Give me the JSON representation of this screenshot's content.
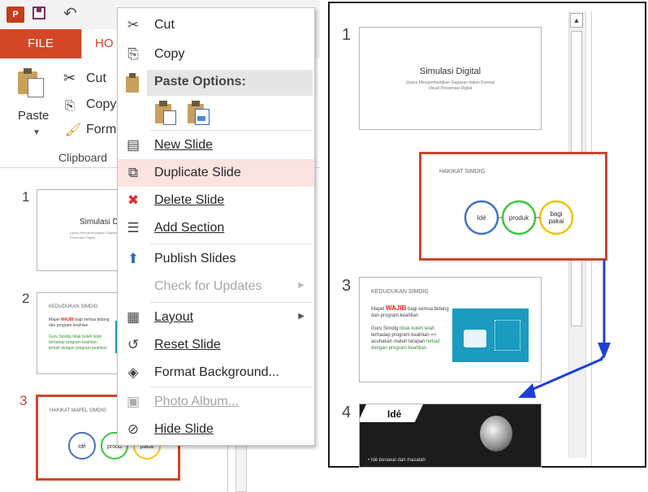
{
  "left": {
    "file_tab": "FILE",
    "home_tab": "HO",
    "ribbon": {
      "paste": "Paste",
      "cut": "Cut",
      "copy": "Copy",
      "format": "Form",
      "group": "Clipboard"
    },
    "thumbs": [
      {
        "num": "1",
        "title": "Simulasi D",
        "sub": "Upaya Mengembangkan Gagasan dalam Konsep Visual Presentasi Digital"
      },
      {
        "num": "2",
        "title": "KEDUDUKAN SIMDIG",
        "bullet1a": "Mapel ",
        "bullet1b": "WAJIB",
        "bullet1c": " bagi semua bidang dan program keahlian",
        "bullet2": "Guru Simdig tidak boleh lelah terhadap program keahlian",
        "bullet3": "terkait dengan program keahlian"
      },
      {
        "num": "3",
        "title": "HAKIKAT MAPEL SIMDIG",
        "c1": "Idé",
        "c2": "produ",
        "c3": "pakai"
      }
    ]
  },
  "menu": {
    "cut": "Cut",
    "copy": "Copy",
    "paste_options": "Paste Options:",
    "new_slide": "New Slide",
    "duplicate_slide": "Duplicate Slide",
    "delete_slide": "Delete Slide",
    "add_section": "Add Section",
    "publish_slides": "Publish Slides",
    "check_updates": "Check for Updates",
    "layout": "Layout",
    "reset_slide": "Reset Slide",
    "format_background": "Format Background...",
    "photo_album": "Photo Album...",
    "hide_slide": "Hide Slide"
  },
  "right": {
    "slides": [
      {
        "num": "1",
        "title": "Simulasi Digital",
        "sub1": "Upaya Mengembangkan Gagasan dalam Konsep",
        "sub2": "Visual Presentasi Digital"
      },
      {
        "title": "HAKIKAT SIMDIG",
        "c1": "Idé",
        "c2": "produk",
        "c3a": "bagi",
        "c3b": "pakai"
      },
      {
        "num": "3",
        "title": "KEDUDUKAN SIMDIG",
        "b1a": "Mapel ",
        "b1b": "WAJIB",
        "b1c": " bagi semua bidang dan program keahlian",
        "b2a": "Guru Simdig ",
        "b2b": "tidak boleh lelah",
        "b2c": " terhadap program keahlian => acuhakan materi terapan ",
        "b2d": "terkait dengan program keahlian"
      },
      {
        "num": "4",
        "title": "Idé",
        "text": "Idé berawal dari masalah"
      }
    ]
  },
  "colors": {
    "accent": "#d24726",
    "select": "#c8482c",
    "arrow": "#1e3fd6",
    "circle1": "#4472c4",
    "circle2": "#3cc73c",
    "circle3": "#f2c40f"
  }
}
